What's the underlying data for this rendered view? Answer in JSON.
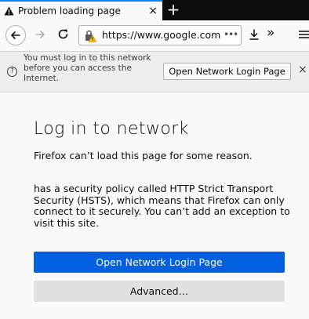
{
  "tab": {
    "title": "Problem loading page",
    "close_glyph": "×",
    "icon": "warning-icon"
  },
  "tabbar": {
    "new_tab_glyph": "+"
  },
  "navbar": {
    "url_main": "https://www.google.com",
    "url_dim": "",
    "page_actions_glyph": "•••",
    "overflow_glyph": "»",
    "icons": [
      "back-arrow-icon",
      "forward-arrow-icon",
      "reload-icon",
      "lock-warning-icon",
      "download-icon",
      "hamburger-menu-icon"
    ]
  },
  "captive_portal": {
    "message": "You must log in to this network before you can access the Internet.",
    "button_label": "Open Network Login Page",
    "close_glyph": "×",
    "icon_glyph": "?"
  },
  "error_page": {
    "title": "Log in to network",
    "short_desc": "Firefox can’t load this page for some reason.",
    "long_desc": "has a security policy called HTTP Strict Transport Security (HSTS), which means that Firefox can only connect to it securely. You can’t add an exception to visit this site.",
    "primary_button": "Open Network Login Page",
    "advanced_button": "Advanced…"
  },
  "colors": {
    "accent": "#0a84ff",
    "primary_button": "#0060df",
    "warning_lock": "#ffbf00"
  }
}
